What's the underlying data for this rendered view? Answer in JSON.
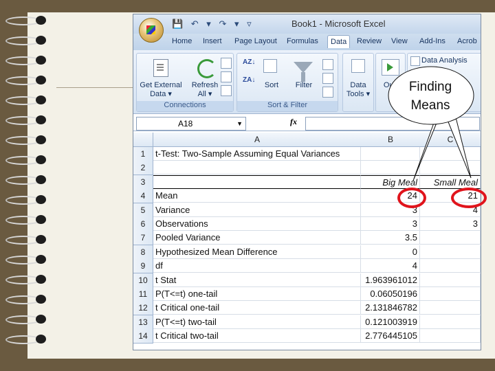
{
  "window": {
    "title": "Book1 - Microsoft Excel",
    "quick_access": "💾 ↶ ▾ ↷ ▾ ▿"
  },
  "tabs": [
    "Home",
    "Insert",
    "Page Layout",
    "Formulas",
    "Data",
    "Review",
    "View",
    "Add-Ins",
    "Acrob"
  ],
  "active_tab": "Data",
  "ribbon": {
    "get_external_data": "Get External Data ▾",
    "refresh_all": "Refresh All ▾",
    "connections_group": "Connections",
    "sort_label": "Sort",
    "filter_label": "Filter",
    "sort_filter_group": "Sort & Filter",
    "data_tools": "Data Tools ▾",
    "outline": "Outl",
    "data_analysis": "Data Analysis",
    "sort_az_icon": "A Z ↓",
    "sort_za_icon": "Z↓A",
    "az_small": "AZ↓",
    "za_small": "ZA↓"
  },
  "formula_bar": {
    "name_box": "A18",
    "fx": "fx",
    "content": ""
  },
  "columns": [
    "A",
    "B",
    "C"
  ],
  "rows": [
    {
      "n": "1",
      "a": "t-Test: Two-Sample Assuming Equal Variances",
      "b": "",
      "c": ""
    },
    {
      "n": "2",
      "a": "",
      "b": "",
      "c": ""
    },
    {
      "n": "3",
      "a": "",
      "b": "Big Meal",
      "c": "Small Meal"
    },
    {
      "n": "4",
      "a": "Mean",
      "b": "24",
      "c": "21"
    },
    {
      "n": "5",
      "a": "Variance",
      "b": "3",
      "c": "4"
    },
    {
      "n": "6",
      "a": "Observations",
      "b": "3",
      "c": "3"
    },
    {
      "n": "7",
      "a": "Pooled Variance",
      "b": "3.5",
      "c": ""
    },
    {
      "n": "8",
      "a": "Hypothesized Mean Difference",
      "b": "0",
      "c": ""
    },
    {
      "n": "9",
      "a": "df",
      "b": "4",
      "c": ""
    },
    {
      "n": "10",
      "a": "t Stat",
      "b": "1.963961012",
      "c": ""
    },
    {
      "n": "11",
      "a": "P(T<=t) one-tail",
      "b": "0.06050196",
      "c": ""
    },
    {
      "n": "12",
      "a": "t Critical one-tail",
      "b": "2.131846782",
      "c": ""
    },
    {
      "n": "13",
      "a": "P(T<=t) two-tail",
      "b": "0.121003919",
      "c": ""
    },
    {
      "n": "14",
      "a": "t Critical two-tail",
      "b": "2.776445105",
      "c": ""
    }
  ],
  "callout": {
    "line1": "Finding",
    "line2": "Means"
  },
  "colors": {
    "highlight": "#e0141c",
    "background": "#6a5a40",
    "paper": "#f3f1e7"
  }
}
